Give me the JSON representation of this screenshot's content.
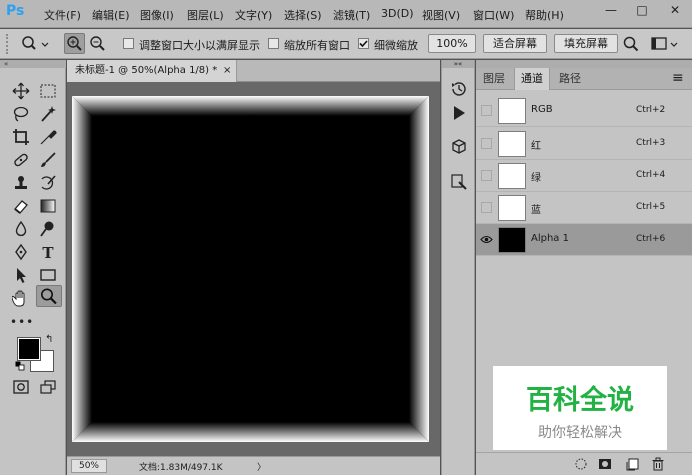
{
  "app": {
    "logo": "Ps"
  },
  "menu": [
    "文件(F)",
    "编辑(E)",
    "图像(I)",
    "图层(L)",
    "文字(Y)",
    "选择(S)",
    "滤镜(T)",
    "3D(D)",
    "视图(V)",
    "窗口(W)",
    "帮助(H)"
  ],
  "window_controls": {
    "minimize": "—",
    "restore": "□",
    "close": "✕"
  },
  "options": {
    "resize_windows_label": "调整窗口大小以满屏显示",
    "zoom_all_label": "缩放所有窗口",
    "scrubby_zoom_label": "细微缩放",
    "scrubby_zoom_checked": true,
    "zoom_100_button": "100%",
    "fit_screen_button": "适合屏幕",
    "fill_screen_button": "填充屏幕"
  },
  "document": {
    "tab_title": "未标题-1 @ 50%(Alpha 1/8) *",
    "tab_close": "×"
  },
  "status": {
    "zoom": "50%",
    "doc_info": "文档:1.83M/497.1K",
    "arrow": "〉"
  },
  "panel": {
    "tabs": [
      "图层",
      "通道",
      "路径"
    ],
    "active_tab": 1,
    "menu_icon": "≡",
    "channels": [
      {
        "name": "RGB",
        "shortcut": "Ctrl+2",
        "thumb": "white",
        "visible": false,
        "selected": false
      },
      {
        "name": "红",
        "shortcut": "Ctrl+3",
        "thumb": "white",
        "visible": false,
        "selected": false
      },
      {
        "name": "绿",
        "shortcut": "Ctrl+4",
        "thumb": "white",
        "visible": false,
        "selected": false
      },
      {
        "name": "蓝",
        "shortcut": "Ctrl+5",
        "thumb": "white",
        "visible": false,
        "selected": false
      },
      {
        "name": "Alpha 1",
        "shortcut": "Ctrl+6",
        "thumb": "black",
        "visible": true,
        "selected": true
      }
    ]
  },
  "watermark": {
    "title": "百科全说",
    "subtitle": "助你轻松解决"
  },
  "colors": {
    "accent_blue": "#2da0f0",
    "watermark_green": "#21b243",
    "foreground": "#000000",
    "background": "#ffffff"
  }
}
